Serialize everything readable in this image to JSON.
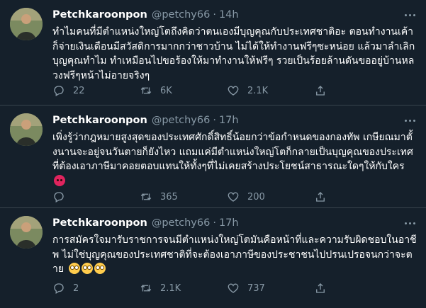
{
  "theme": {
    "background": "#15202b",
    "text": "#ffffff",
    "muted": "#8899a6",
    "divider": "#38444d",
    "angry_emoji": "#e0245e",
    "roll_emoji": "#ffcc4d"
  },
  "tweets": [
    {
      "name": "Petchkaroonpon",
      "handle": "@petchy66",
      "dot": "·",
      "time": "14h",
      "text": "ทำไมคนที่มีตำแหน่งใหญ่โตถึงคิดว่าตนเองมีบุญคุณกับประเทศชาติอะ ตอนทำงานเค้าก็จ่ายเงินเดือนมีสวัสดิการมากกว่าชาวบ้าน ไม่ได้ให้ทำงานฟรีๆซะหน่อย แล้วมาลำเลิกบุญคุณทำไม ทำเหมือนไปขอร้องให้มาทำงานให้ฟรีๆ รวยเป็นร้อยล้านดันขออยู่บ้านหลวงฟรีๆหน้าไม่อายจริงๆ",
      "reply_icon": "comment-icon",
      "reply_count": "22",
      "retweet_icon": "retweet-icon",
      "retweet_count": "6K",
      "like_icon": "heart-icon",
      "like_count": "2.1K",
      "share_icon": "share-icon"
    },
    {
      "name": "Petchkaroonpon",
      "handle": "@petchy66",
      "dot": "·",
      "time": "17h",
      "text": "เพิ่งรู้ว่ากฎหมายสูงสุดของประเทศศักดิ์สิทธิ์น้อยกว่าข้อกำหนดของกองทัพ เกษียณมาตั้งนานจะอยู่จนวันตายก็ยังไหว แถมแค่มีตำแหน่งใหญ่โตก็กลายเป็นบุญคุณของประเทศที่ต้องเอาภาษีมาคอยตอบแทนให้ทั้งๆที่ไม่เคยสร้างประโยชน์สาธารณะใดๆให้กับใคร",
      "emoji": [
        "angry-face-emoji"
      ],
      "reply_icon": "comment-icon",
      "reply_count": "",
      "retweet_icon": "retweet-icon",
      "retweet_count": "365",
      "like_icon": "heart-icon",
      "like_count": "200",
      "share_icon": "share-icon"
    },
    {
      "name": "Petchkaroonpon",
      "handle": "@petchy66",
      "dot": "·",
      "time": "17h",
      "text": "การสมัครใจมารับราชการจนมีตำแหน่งใหญ่โตมันคือหน้าที่และความรับผิดชอบในอาชีพ ไม่ใช่บุญคุณของประเทศชาติที่จะต้องเอาภาษีของประชาชนไปปรนเปรอจนกว่าจะตาย",
      "emoji": [
        "eye-roll-emoji",
        "eye-roll-emoji",
        "eye-roll-emoji"
      ],
      "reply_icon": "comment-icon",
      "reply_count": "2",
      "retweet_icon": "retweet-icon",
      "retweet_count": "2.1K",
      "like_icon": "heart-icon",
      "like_count": "737",
      "share_icon": "share-icon"
    }
  ]
}
